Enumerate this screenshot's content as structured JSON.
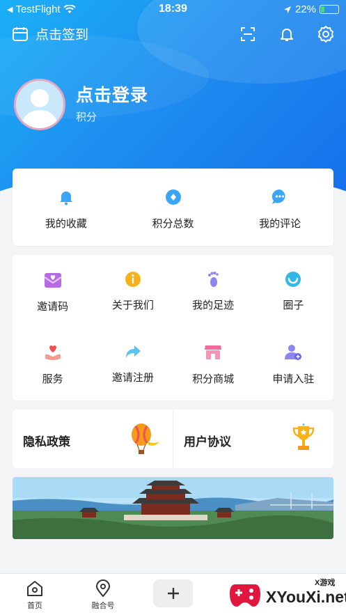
{
  "status_bar": {
    "carrier": "TestFlight",
    "time": "18:39",
    "battery": "22%",
    "battery_fraction": 0.22
  },
  "top_bar": {
    "checkin_label": "点击签到",
    "icons": [
      "calendar-icon",
      "scan-icon",
      "bell-icon",
      "gear-icon"
    ]
  },
  "profile": {
    "login_text": "点击登录",
    "points_label": "积分"
  },
  "quick_stats": [
    {
      "label": "我的收藏",
      "icon": "bell-icon"
    },
    {
      "label": "积分总数",
      "icon": "diamond-icon"
    },
    {
      "label": "我的评论",
      "icon": "chat-bubble-icon"
    }
  ],
  "features": [
    {
      "label": "邀请码",
      "icon": "envelope-heart-icon"
    },
    {
      "label": "关于我们",
      "icon": "info-icon"
    },
    {
      "label": "我的足迹",
      "icon": "footprint-icon"
    },
    {
      "label": "圈子",
      "icon": "circle-icon"
    },
    {
      "label": "服务",
      "icon": "hand-heart-icon"
    },
    {
      "label": "邀请注册",
      "icon": "share-arrow-icon"
    },
    {
      "label": "积分商城",
      "icon": "shop-icon"
    },
    {
      "label": "申请入驻",
      "icon": "user-add-icon"
    }
  ],
  "links": {
    "privacy": "隐私政策",
    "agreement": "用户协议"
  },
  "tab_bar": {
    "home": "首页",
    "media": "融合号"
  },
  "watermark": {
    "site": "XYouXi.net",
    "tag": "X游戏"
  },
  "colors": {
    "primary": "#1e8ef0",
    "hero_light": "#1bb0f7",
    "accent_green": "#4cd964"
  }
}
